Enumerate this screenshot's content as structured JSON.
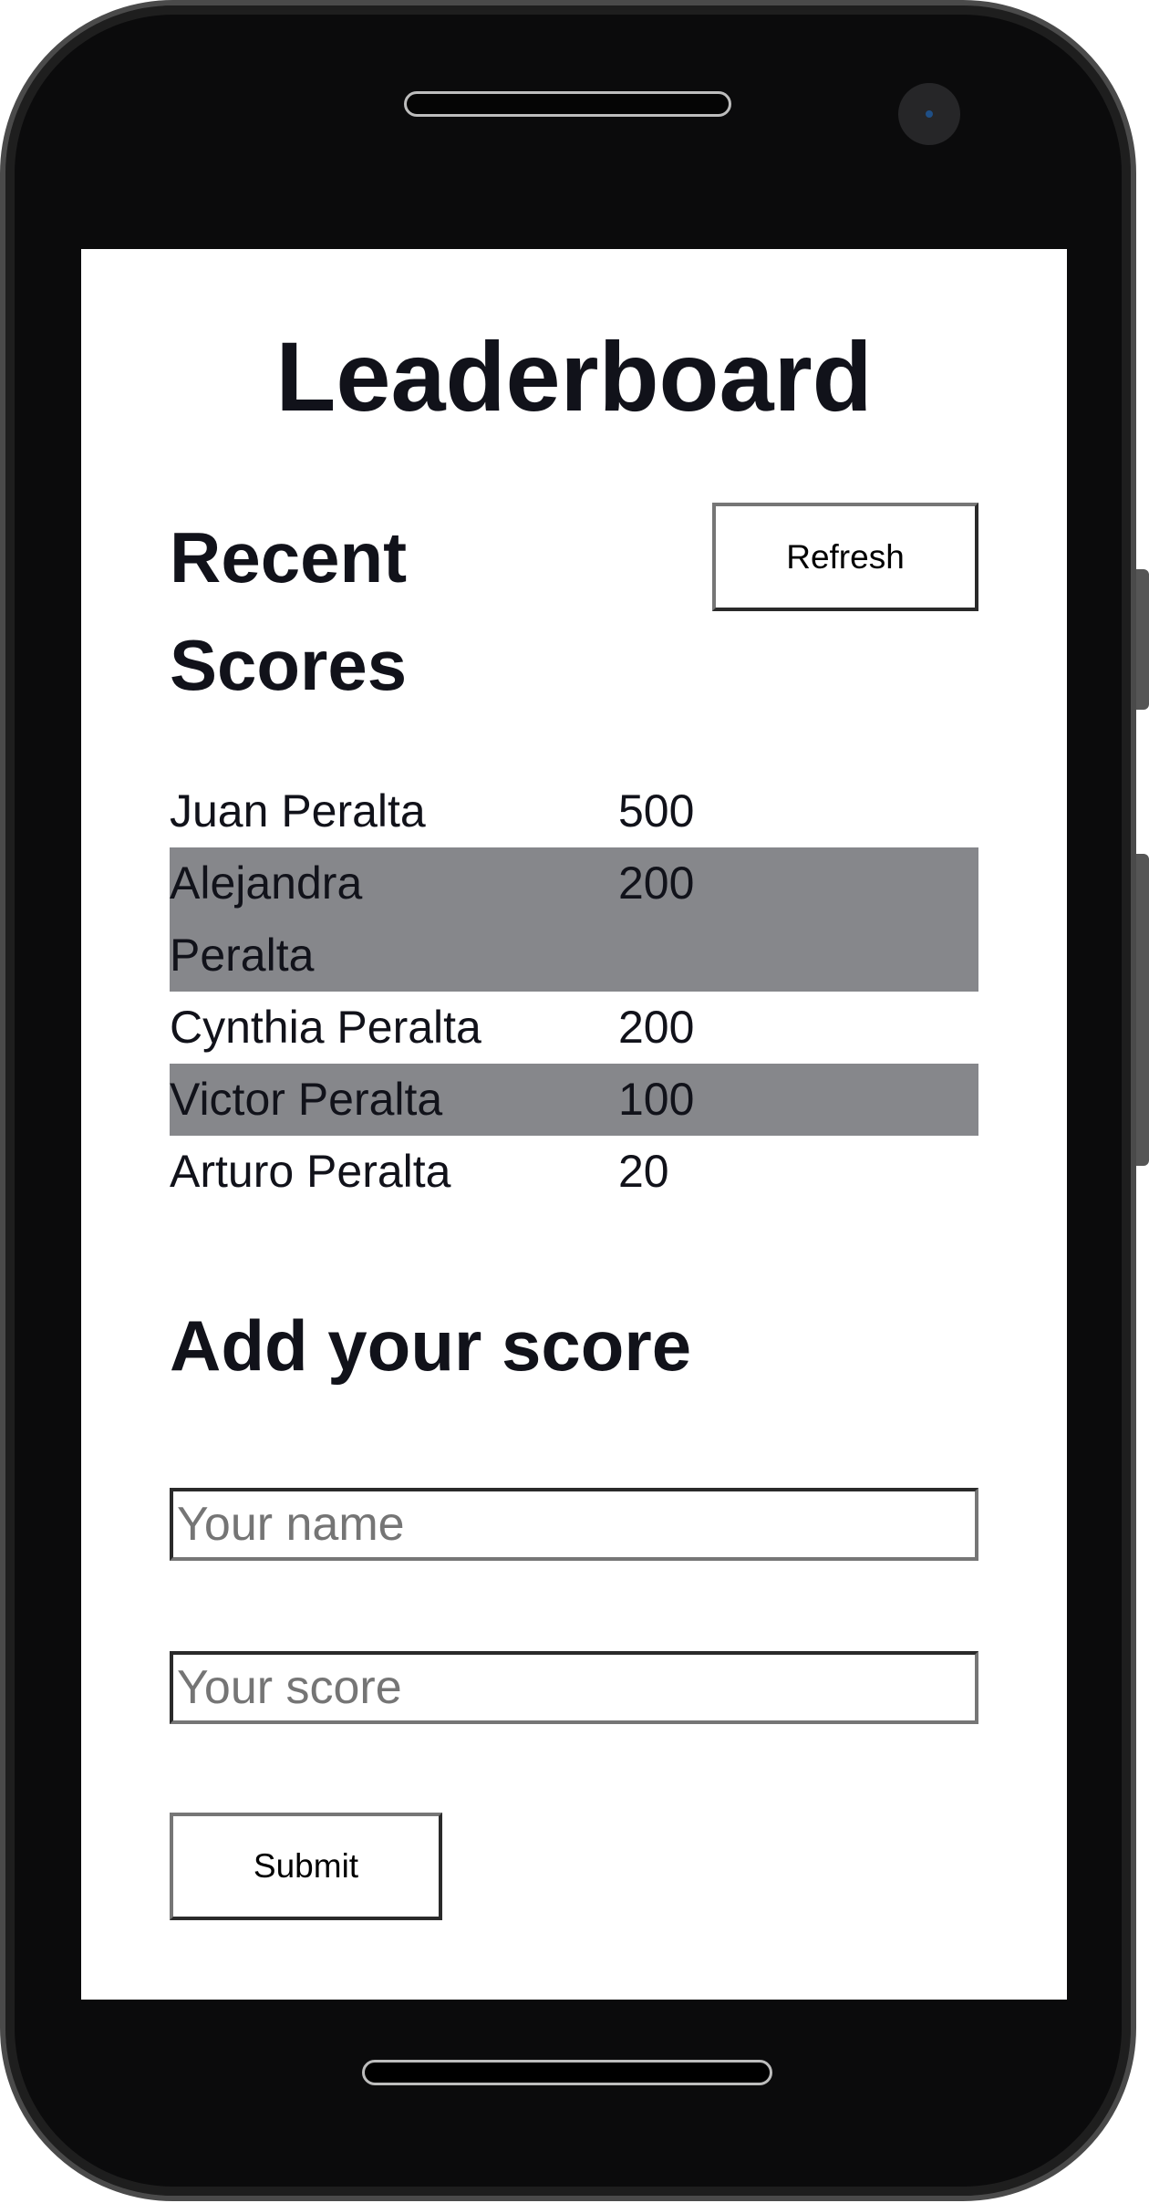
{
  "app": {
    "title": "Leaderboard"
  },
  "recent": {
    "heading_line1": "Recent",
    "heading_line2": "Scores",
    "refresh_label": "Refresh",
    "rows": [
      {
        "name": "Juan Peralta",
        "score": "500"
      },
      {
        "name": "Alejandra Peralta",
        "score": "200"
      },
      {
        "name": "Cynthia Peralta",
        "score": "200"
      },
      {
        "name": "Victor Peralta",
        "score": "100"
      },
      {
        "name": "Arturo Peralta",
        "score": "20"
      }
    ]
  },
  "form": {
    "heading": "Add your score",
    "name_placeholder": "Your name",
    "name_value": "",
    "score_placeholder": "Your score",
    "score_value": "",
    "submit_label": "Submit"
  },
  "colors": {
    "alt_row": "#86878b",
    "text": "#11121a",
    "device": "#0b0b0c"
  }
}
